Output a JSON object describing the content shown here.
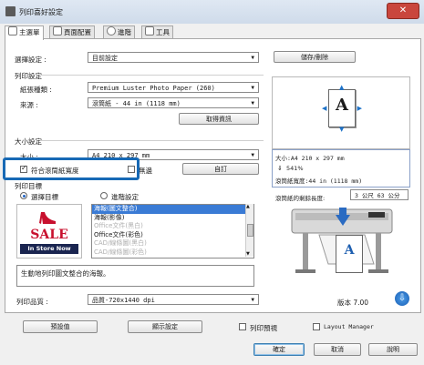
{
  "window": {
    "title": "列印喜好設定",
    "close": "✕"
  },
  "tabs": [
    {
      "label": "主選單"
    },
    {
      "label": "頁面配置"
    },
    {
      "label": "進階"
    },
    {
      "label": "工具"
    }
  ],
  "preset": {
    "label": "選擇設定 :",
    "value": "目前設定",
    "save_button": "儲存/刪除"
  },
  "print_settings": {
    "group_title": "列印設定",
    "media_type_label": "紙張種類 :",
    "media_type_value": "Premium Luster Photo Paper (260)",
    "source_label": "來源 :",
    "source_value": "滾筒紙 - 44 in (1118 mm)",
    "get_info_button": "取得資訊"
  },
  "size_settings": {
    "group_title": "大小設定",
    "size_label": "大小 :",
    "size_value": "A4 210 x 297 mm",
    "fit_roll_label": "符合滾筒紙寬度",
    "fit_roll_checked": true,
    "borderless_label": "無邊",
    "borderless_checked": false,
    "custom_button": "自訂"
  },
  "print_target": {
    "group_title": "列印目標",
    "radio_select_target": "選擇目標",
    "radio_advanced": "進階設定",
    "selected": "選擇目標",
    "items": [
      "海報(圖文整合)",
      "海報(影像)",
      "Office文件(黑白)",
      "Office文件(彩色)",
      "CAD/線條圖(黑白)",
      "CAD/線條圖(彩色)"
    ],
    "selected_index": 0,
    "dim_indices": [
      2,
      4,
      5
    ],
    "sale_top": "SALE",
    "sale_bottom": "In Store Now",
    "description": "生動地列印圖文整合的海報。"
  },
  "quality": {
    "label": "列印品質 :",
    "value": "品質-720x1440 dpi"
  },
  "preview": {
    "letter": "A"
  },
  "info": {
    "size_line": "大小:A4 210 x 297 mm",
    "scale_line": "541%",
    "roll_width_line": "滾筒紙寬度:44 in (1118 mm)",
    "remaining_label": "滾筒紙的剩餘長度:",
    "remaining_value": "3 公尺 63 公分"
  },
  "version": "版本 7.00",
  "bottom": {
    "defaults_button": "預設值",
    "display_settings_button": "顯示設定",
    "preview_label": "列印預視",
    "layout_manager_label": "Layout Manager",
    "ok_button": "確定",
    "cancel_button": "取消",
    "help_button": "說明"
  }
}
